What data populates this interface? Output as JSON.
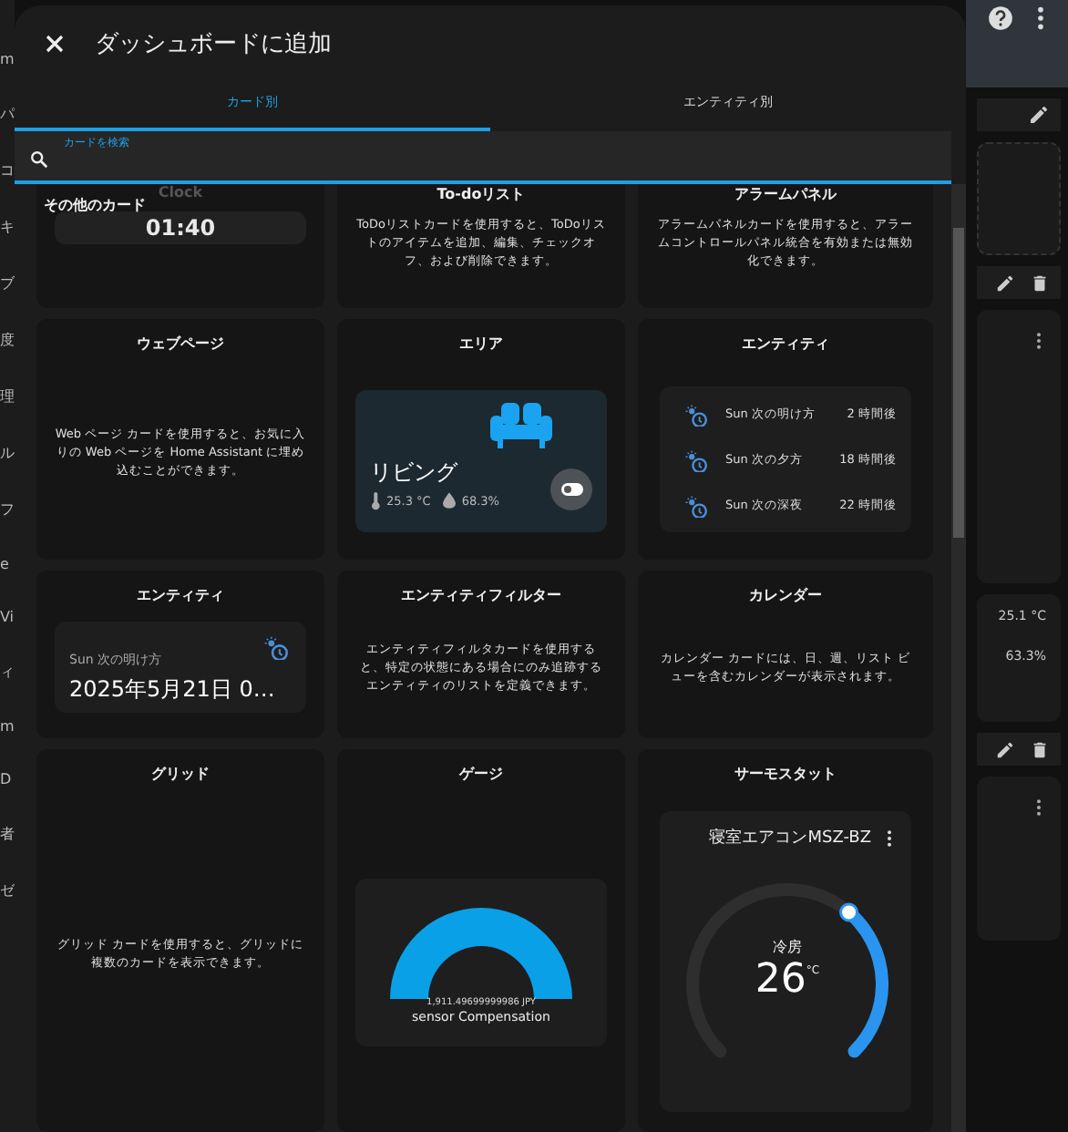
{
  "background": {
    "left_fragments": [
      "m",
      "パ",
      "コ",
      "キ",
      "ブ",
      "度",
      "理",
      "ル",
      "フ",
      "e",
      "Vi",
      "ィ",
      "m",
      "D",
      "者",
      "ゼ"
    ],
    "right_readings": [
      "25.1 °C",
      "63.3%"
    ]
  },
  "dialog": {
    "title": "ダッシュボードに追加",
    "tabs": [
      {
        "label": "カード別",
        "selected": true
      },
      {
        "label": "エンティティ別",
        "selected": false
      }
    ],
    "search": {
      "placeholder": "カードを検索"
    },
    "section_title": "その他のカード",
    "cards": [
      {
        "kind": "clock",
        "title": "Clock",
        "time": "01:40"
      },
      {
        "kind": "description",
        "title": "To-doリスト",
        "description": "ToDoリストカードを使用すると、ToDoリストのアイテムを追加、編集、チェックオフ、および削除できます。"
      },
      {
        "kind": "description",
        "title": "アラームパネル",
        "description": "アラームパネルカードを使用すると、アラームコントロールパネル統合を有効または無効化できます。"
      },
      {
        "kind": "description",
        "title": "ウェブページ",
        "description": "Web ページ カードを使用すると、お気に入りの Web ページを Home Assistant に埋め込むことができます。"
      },
      {
        "kind": "area",
        "title": "エリア",
        "name": "リビング",
        "temperature": "25.3 °C",
        "humidity": "68.3%"
      },
      {
        "kind": "entities",
        "title": "エンティティ",
        "rows": [
          {
            "name": "Sun 次の明け方",
            "value": "2 時間後"
          },
          {
            "name": "Sun 次の夕方",
            "value": "18 時間後"
          },
          {
            "name": "Sun 次の深夜",
            "value": "22 時間後"
          }
        ]
      },
      {
        "kind": "entity",
        "title": "エンティティ",
        "name": "Sun 次の明け方",
        "state": "2025年5月21日 0…"
      },
      {
        "kind": "description",
        "title": "エンティティフィルター",
        "description": "エンティティフィルタカードを使用すると、特定の状態にある場合にのみ追跡するエンティティのリストを定義できます。"
      },
      {
        "kind": "description",
        "title": "カレンダー",
        "description": "カレンダー カードには、日、週、リスト ビューを含むカレンダーが表示されます。"
      },
      {
        "kind": "description",
        "title": "グリッド",
        "description": "グリッド カードを使用すると、グリッドに複数のカードを表示できます。"
      },
      {
        "kind": "gauge",
        "title": "ゲージ",
        "value": "1,911.49699999986 JPY",
        "name": "sensor Compensation"
      },
      {
        "kind": "thermostat",
        "title": "サーモスタット",
        "name": "寝室エアコンMSZ-BZ",
        "mode": "冷房",
        "target": "26",
        "unit": "°C"
      }
    ]
  }
}
